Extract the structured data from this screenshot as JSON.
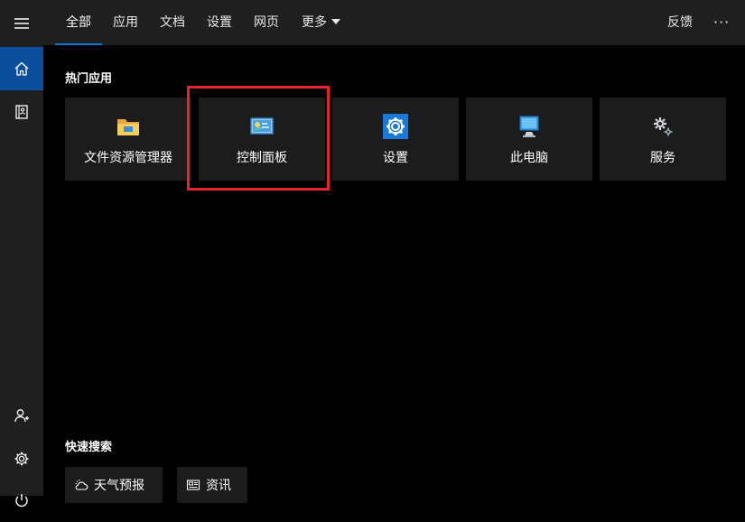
{
  "header": {
    "tabs": [
      {
        "label": "全部"
      },
      {
        "label": "应用"
      },
      {
        "label": "文档"
      },
      {
        "label": "设置"
      },
      {
        "label": "网页"
      },
      {
        "label": "更多"
      }
    ],
    "feedback_label": "反馈",
    "more_options_label": "···"
  },
  "sidebar": {
    "icons": [
      "menu-icon",
      "home-icon",
      "notebook-icon",
      "add-person-icon",
      "gear-icon",
      "power-icon"
    ]
  },
  "hot_apps": {
    "title": "热门应用",
    "items": [
      {
        "label": "文件资源管理器",
        "icon": "file-explorer-icon"
      },
      {
        "label": "控制面板",
        "icon": "control-panel-icon"
      },
      {
        "label": "设置",
        "icon": "settings-gear-icon"
      },
      {
        "label": "此电脑",
        "icon": "this-pc-icon"
      },
      {
        "label": "服务",
        "icon": "services-icon"
      }
    ],
    "highlighted_item": "控制面板",
    "highlight_color": "#e5242b"
  },
  "quick_search": {
    "title": "快速搜索",
    "items": [
      {
        "label": "天气预报",
        "icon": "weather-icon"
      },
      {
        "label": "资讯",
        "icon": "news-icon"
      }
    ]
  },
  "colors": {
    "accent": "#0078d7",
    "active_sidebar": "#0b4f9c",
    "chrome": "#1f1f1f",
    "tile": "#1c1c1c"
  }
}
